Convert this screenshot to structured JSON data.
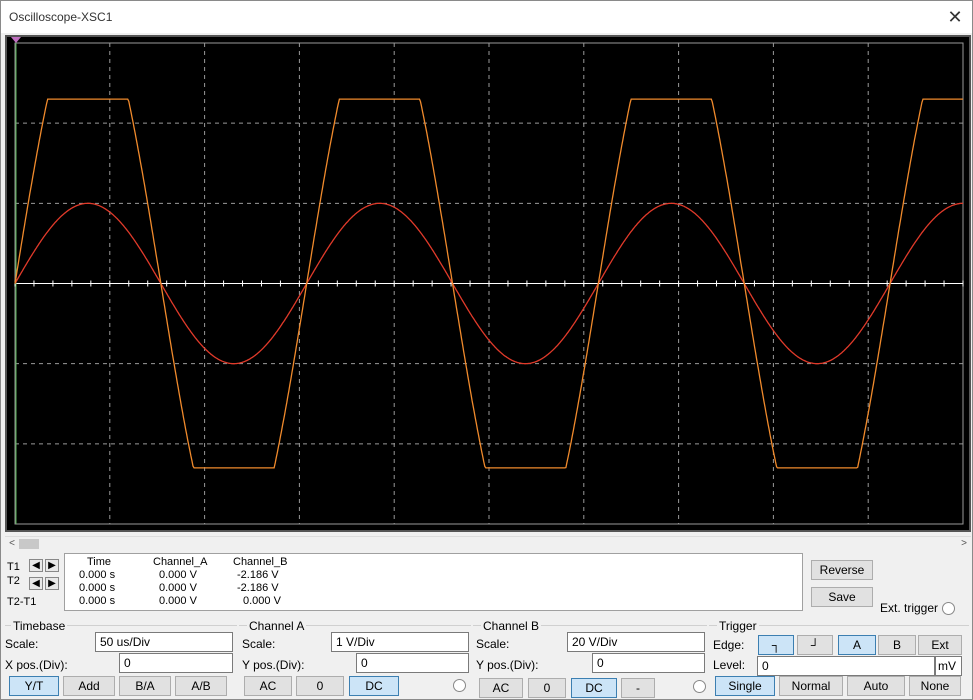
{
  "window": {
    "title": "Oscilloscope-XSC1"
  },
  "cursors": {
    "t1_label": "T1",
    "t2_label": "T2",
    "t2t1_label": "T2-T1"
  },
  "readout": {
    "headers": [
      "Time",
      "Channel_A",
      "Channel_B"
    ],
    "rows": [
      [
        "0.000 s",
        "0.000 V",
        "-2.186 V"
      ],
      [
        "0.000 s",
        "0.000 V",
        "-2.186 V"
      ],
      [
        "0.000 s",
        "0.000 V",
        "0.000 V"
      ]
    ]
  },
  "actions": {
    "reverse": "Reverse",
    "save": "Save",
    "ext_trigger": "Ext. trigger"
  },
  "timebase": {
    "title": "Timebase",
    "scale_label": "Scale:",
    "scale_value": "50 us/Div",
    "xpos_label": "X pos.(Div):",
    "xpos_value": "0",
    "modes": [
      "Y/T",
      "Add",
      "B/A",
      "A/B"
    ],
    "active_mode": "Y/T"
  },
  "channel_a": {
    "title": "Channel A",
    "scale_label": "Scale:",
    "scale_value": "1  V/Div",
    "ypos_label": "Y pos.(Div):",
    "ypos_value": "0",
    "coupling": [
      "AC",
      "0",
      "DC"
    ],
    "active_coupling": "DC"
  },
  "channel_b": {
    "title": "Channel B",
    "scale_label": "Scale:",
    "scale_value": "20  V/Div",
    "ypos_label": "Y pos.(Div):",
    "ypos_value": "0",
    "coupling": [
      "AC",
      "0",
      "DC",
      "-"
    ],
    "active_coupling": "DC"
  },
  "trigger": {
    "title": "Trigger",
    "edge_label": "Edge:",
    "sources": [
      "A",
      "B",
      "Ext"
    ],
    "active_source": "A",
    "level_label": "Level:",
    "level_value": "0",
    "level_unit": "mV",
    "modes": [
      "Single",
      "Normal",
      "Auto",
      "None"
    ],
    "active_mode": "Single"
  },
  "colors": {
    "channel_a_trace": "#e03a2a",
    "channel_b_trace": "#f08a2c",
    "screen_bg": "#000000",
    "grid": "#9a9a9a"
  },
  "chart_data": {
    "type": "line",
    "grid_divisions": {
      "x": 10,
      "y": 6
    },
    "series": [
      {
        "name": "Channel_A",
        "shape": "sine",
        "periods": 3.25,
        "peak_div": 1.0
      },
      {
        "name": "Channel_B",
        "shape": "clipped-sine",
        "periods": 3.25,
        "peak_div": 2.3
      }
    ]
  }
}
